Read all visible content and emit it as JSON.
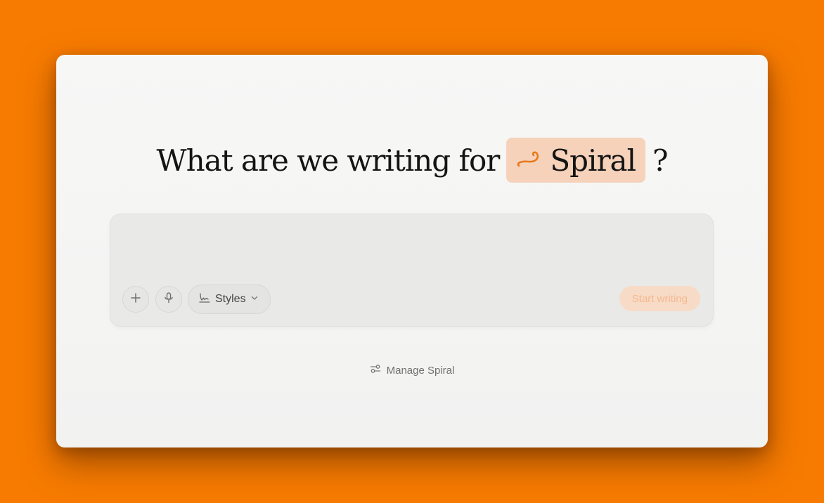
{
  "prompt": {
    "text": "What are we writing for",
    "workspace_label": "Spiral",
    "question_mark": "?"
  },
  "composer": {
    "input_value": "",
    "styles_label": "Styles",
    "start_label": "Start writing"
  },
  "footer": {
    "manage_label": "Manage Spiral"
  },
  "colors": {
    "background": "#f77b00",
    "chip_bg": "#f6d2bb",
    "accent": "#e77a1a",
    "start_button_bg": "#f8dbc6",
    "start_button_text": "#f4b890"
  },
  "icons": {
    "workspace": "spiral-icon",
    "attach": "plus-icon",
    "voice": "microphone-icon",
    "styles": "signature-icon",
    "dropdown": "chevron-down-icon",
    "manage": "sliders-icon"
  }
}
